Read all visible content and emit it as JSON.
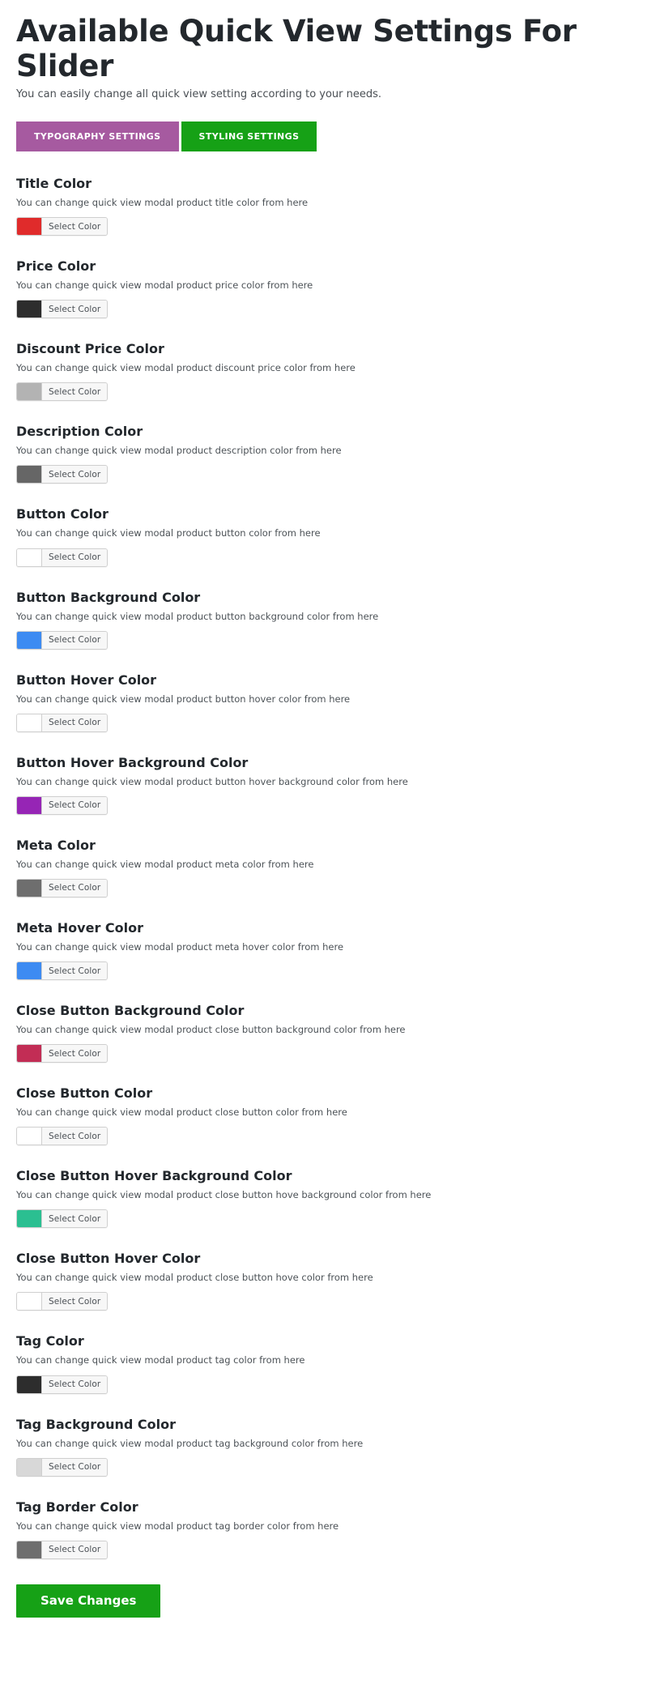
{
  "header": {
    "title": "Available Quick View Settings For Slider",
    "subtitle": "You can easily change all quick view setting according to your needs."
  },
  "tabs": [
    {
      "label": "TYPOGRAPHY SETTINGS",
      "color": "#a65aa0",
      "active": false
    },
    {
      "label": "STYLING SETTINGS",
      "color": "#16a116",
      "active": true
    }
  ],
  "select_color_label": "Select Color",
  "settings": [
    {
      "title": "Title Color",
      "description": "You can change quick view modal product title color from here",
      "swatch": "#e02b2b",
      "button_label": "Select Color"
    },
    {
      "title": "Price Color",
      "description": "You can change quick view modal product price color from here",
      "swatch": "#2d2d2d",
      "button_label": "Select Color"
    },
    {
      "title": "Discount Price Color",
      "description": "You can change quick view modal product discount price color from here",
      "swatch": "#b3b3b3",
      "button_label": "Select Color"
    },
    {
      "title": "Description Color",
      "description": "You can change quick view modal product description color from here",
      "swatch": "#666666",
      "button_label": "Select Color"
    },
    {
      "title": "Button Color",
      "description": "You can change quick view modal product button color from here",
      "swatch": "#ffffff",
      "button_label": "Select Color"
    },
    {
      "title": "Button Background Color",
      "description": "You can change quick view modal product button background color from here",
      "swatch": "#3d8bf2",
      "button_label": "Select Color"
    },
    {
      "title": "Button Hover Color",
      "description": "You can change quick view modal product button hover color from here",
      "swatch": "#ffffff",
      "button_label": "Select Color"
    },
    {
      "title": "Button Hover Background Color",
      "description": "You can change quick view modal product button hover background color from here",
      "swatch": "#9625b5",
      "button_label": "Select Color"
    },
    {
      "title": "Meta Color",
      "description": "You can change quick view modal product meta color from here",
      "swatch": "#6e6e6e",
      "button_label": "Select Color"
    },
    {
      "title": "Meta Hover Color",
      "description": "You can change quick view modal product meta hover color from here",
      "swatch": "#3d8bf2",
      "button_label": "Select Color"
    },
    {
      "title": "Close Button Background Color",
      "description": "You can change quick view modal product close button background color from here",
      "swatch": "#c22d55",
      "button_label": "Select Color"
    },
    {
      "title": "Close Button Color",
      "description": "You can change quick view modal product close button color from here",
      "swatch": "#ffffff",
      "button_label": "Select Color"
    },
    {
      "title": "Close Button Hover Background Color",
      "description": "You can change quick view modal product close button hove background color from here",
      "swatch": "#2bbf91",
      "button_label": "Select Color"
    },
    {
      "title": "Close Button Hover Color",
      "description": "You can change quick view modal product close button hove color from here",
      "swatch": "#ffffff",
      "button_label": "Select Color"
    },
    {
      "title": "Tag Color",
      "description": "You can change quick view modal product tag color from here",
      "swatch": "#2d2d2d",
      "button_label": "Select Color"
    },
    {
      "title": "Tag Background Color",
      "description": "You can change quick view modal product tag background color from here",
      "swatch": "#d8d8d8",
      "button_label": "Select Color"
    },
    {
      "title": "Tag Border Color",
      "description": "You can change quick view modal product tag border color from here",
      "swatch": "#6e6e6e",
      "button_label": "Select Color"
    }
  ],
  "save": {
    "label": "Save Changes",
    "color": "#16a116"
  }
}
